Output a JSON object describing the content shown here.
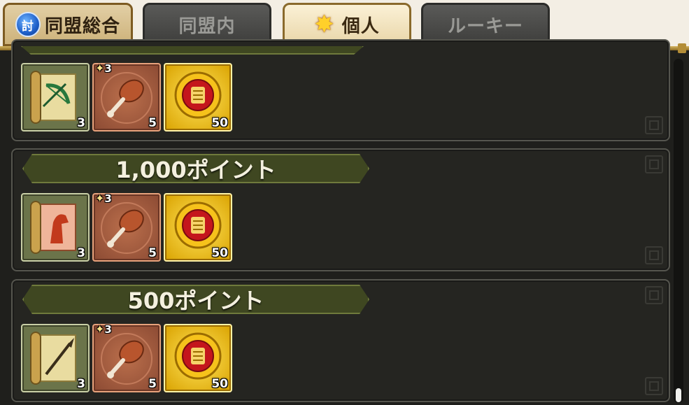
{
  "tabs": [
    {
      "label": "同盟総合",
      "emblem": "討",
      "state": "active"
    },
    {
      "label": "同盟内",
      "state": "inactive"
    },
    {
      "label": "個人",
      "state": "selected"
    },
    {
      "label": "ルーキー",
      "state": "inactive"
    }
  ],
  "colors": {
    "banner": "#3f4721",
    "gold": "#d9a200",
    "bronze": "#8b4a33",
    "scroll": "#6b744a"
  },
  "reward_tiers": [
    {
      "label": "",
      "items": [
        {
          "icon": "bow-scroll-icon",
          "quantity": "3"
        },
        {
          "icon": "meat-icon",
          "grade": "3",
          "quantity": "5"
        },
        {
          "icon": "gold-coin-icon",
          "quantity": "50"
        }
      ]
    },
    {
      "label": "1,000ポイント",
      "items": [
        {
          "icon": "horse-scroll-icon",
          "quantity": "3"
        },
        {
          "icon": "meat-icon",
          "grade": "3",
          "quantity": "5"
        },
        {
          "icon": "gold-coin-icon",
          "quantity": "50"
        }
      ]
    },
    {
      "label": "500ポイント",
      "items": [
        {
          "icon": "spear-scroll-icon",
          "quantity": "3"
        },
        {
          "icon": "meat-icon",
          "grade": "3",
          "quantity": "5"
        },
        {
          "icon": "gold-coin-icon",
          "quantity": "50"
        }
      ]
    }
  ]
}
